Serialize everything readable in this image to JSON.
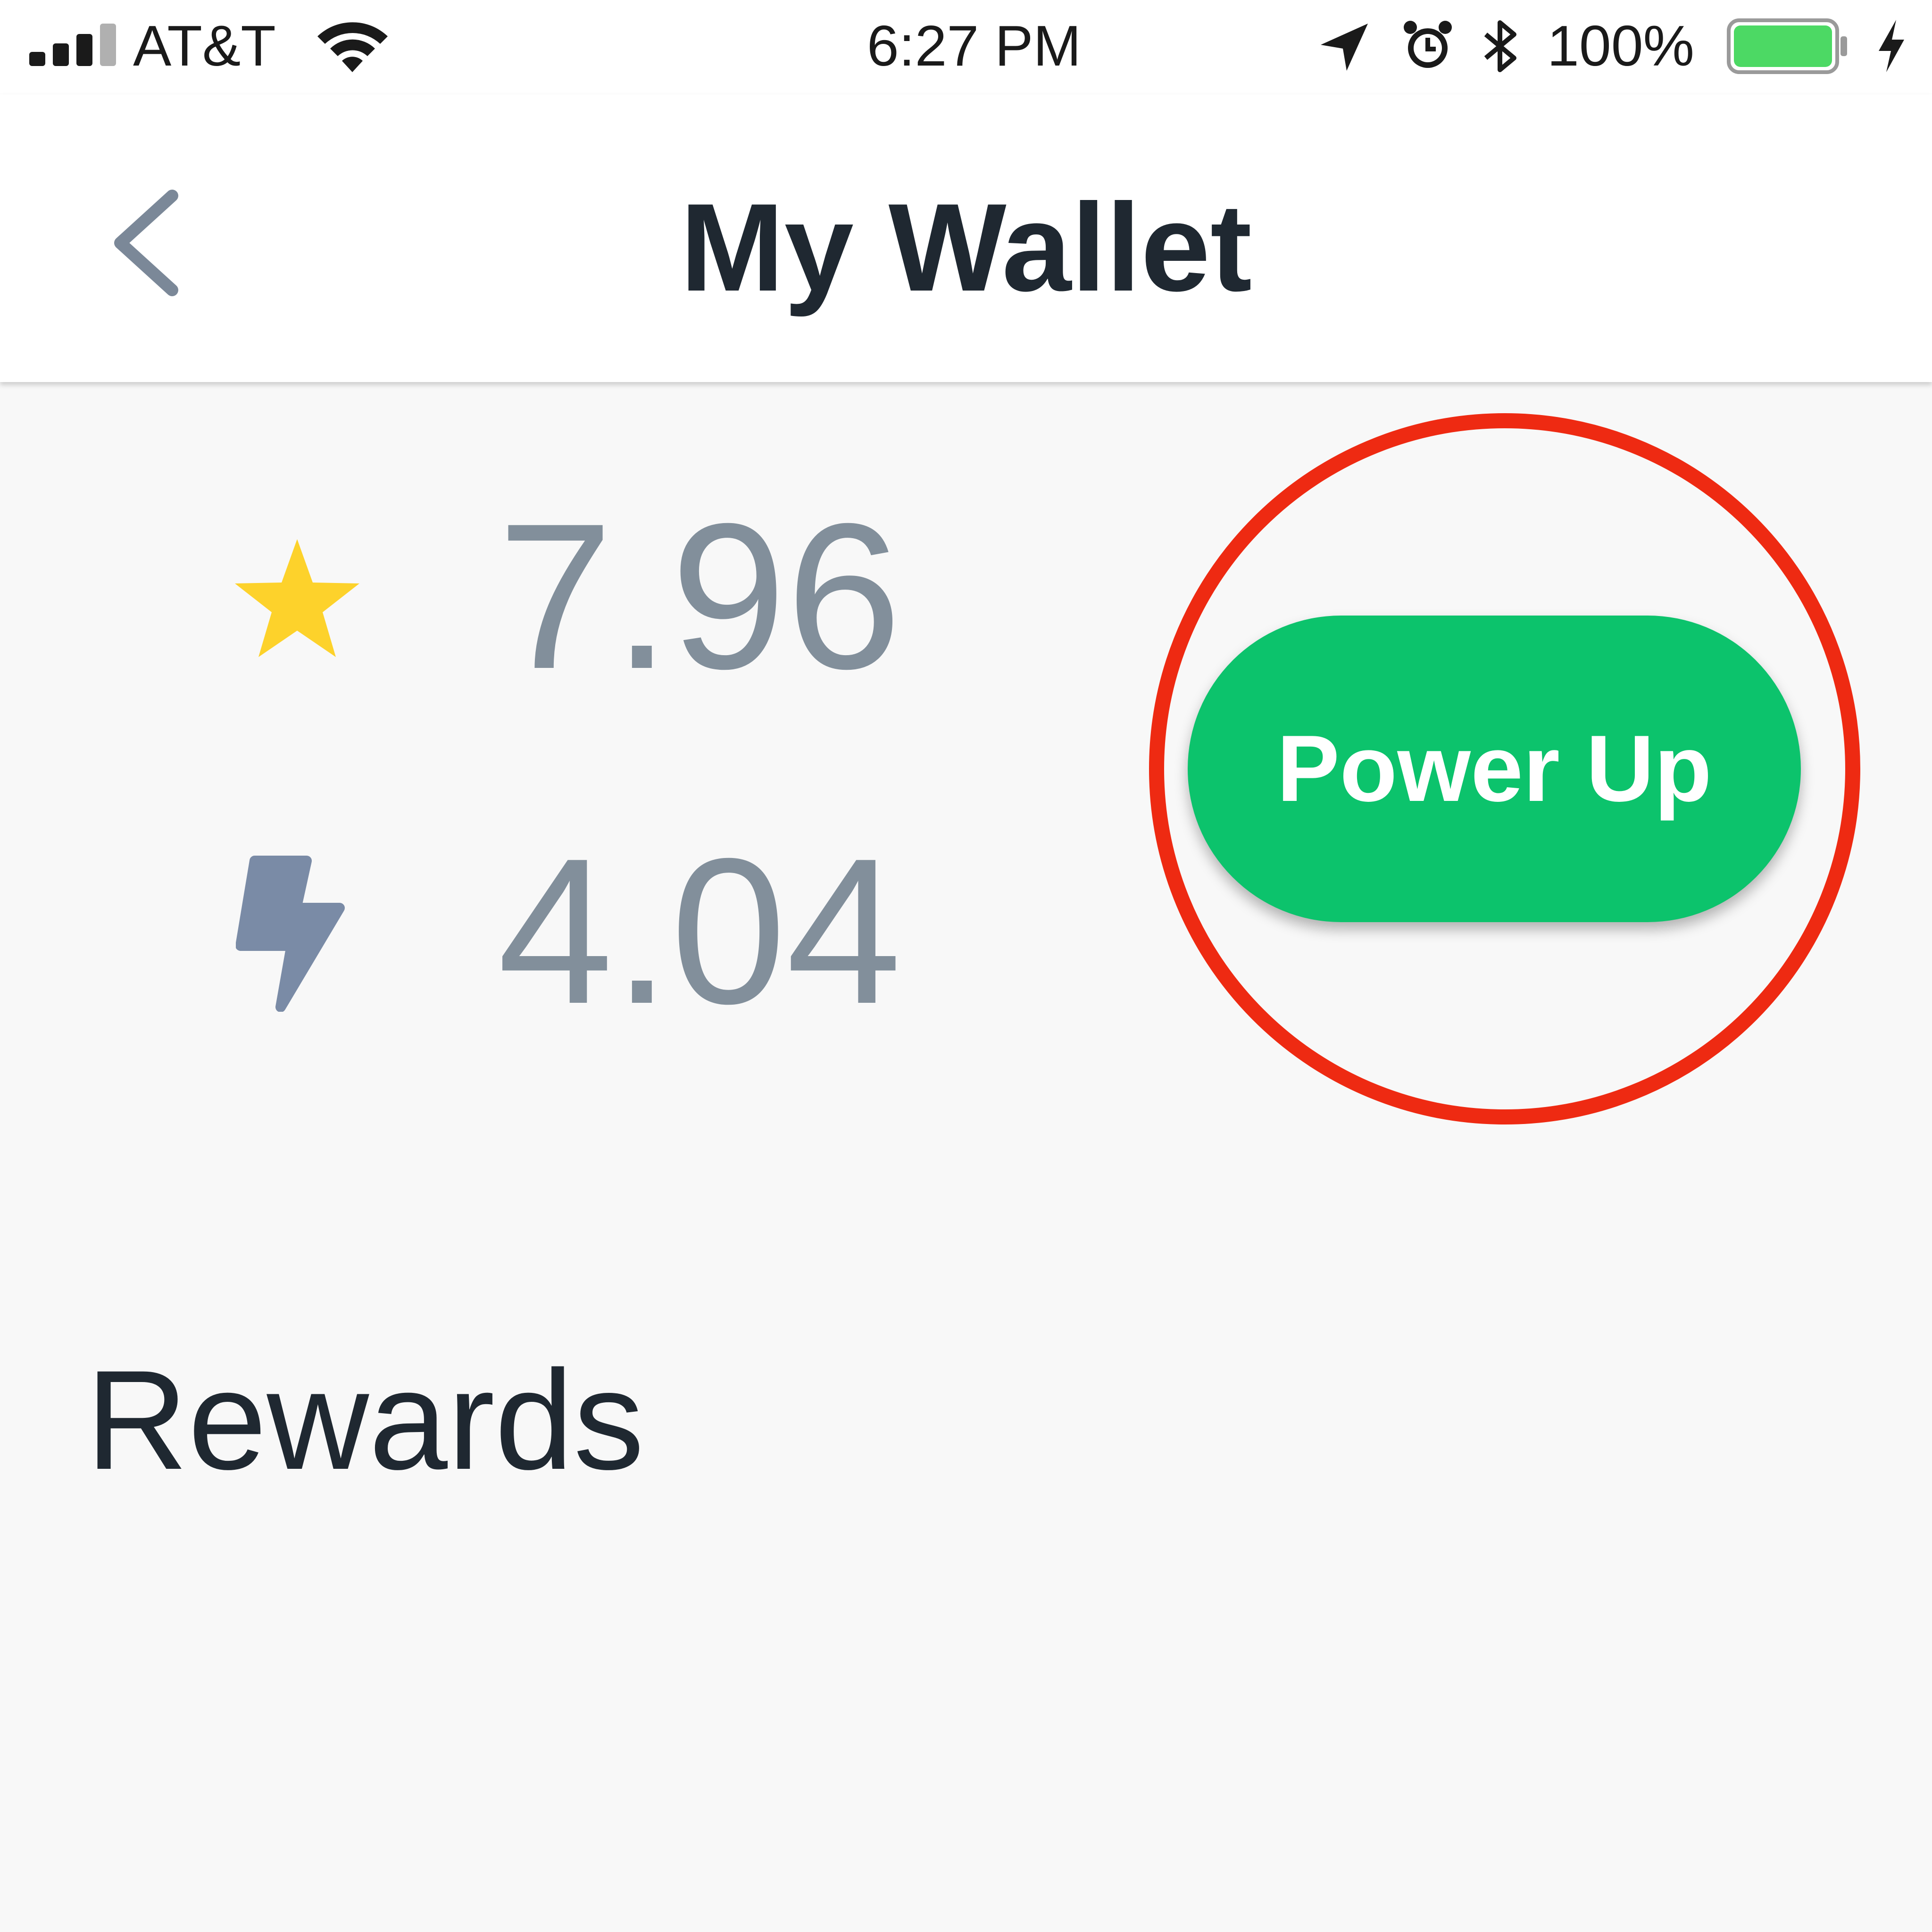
{
  "status_bar": {
    "carrier": "AT&T",
    "time": "6:27 PM",
    "battery_percent": "100%",
    "battery_level": 1.0,
    "signal_bars": 4,
    "signal_bars_filled": 3,
    "battery_color": "#4cd964",
    "icons": [
      "signal-icon",
      "wifi-icon",
      "location-arrow-icon",
      "alarm-icon",
      "bluetooth-icon",
      "battery-icon",
      "charging-icon"
    ]
  },
  "nav": {
    "title": "My Wallet",
    "back_icon": "chevron-left-icon"
  },
  "wallet": {
    "points_icon": "star-icon",
    "points_value": "7.96",
    "power_icon": "lightning-bolt-icon",
    "power_value": "4.04",
    "power_up_label": "Power Up"
  },
  "sections": {
    "rewards_heading": "Rewards"
  },
  "colors": {
    "accent_green": "#0cc36c",
    "highlight_red": "#ee2a12",
    "star_yellow": "#fdd22b",
    "value_gray": "#828f9b",
    "bolt_blue_gray": "#7a8ba6",
    "text_dark": "#1f2831"
  }
}
